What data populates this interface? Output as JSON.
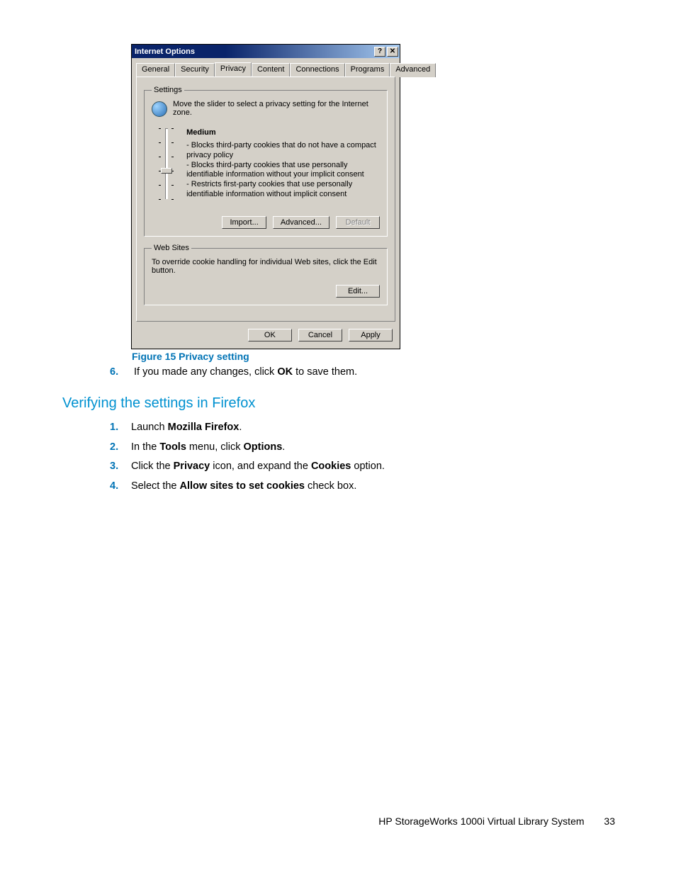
{
  "dialog": {
    "title": "Internet Options",
    "help_glyph": "?",
    "close_glyph": "✕",
    "tabs": [
      "General",
      "Security",
      "Privacy",
      "Content",
      "Connections",
      "Programs",
      "Advanced"
    ],
    "active_tab": "Privacy",
    "settings": {
      "legend": "Settings",
      "instruction": "Move the slider to select a privacy setting for the Internet zone.",
      "level": "Medium",
      "bullets": [
        "- Blocks third-party cookies that do not have a compact privacy policy",
        "- Blocks third-party cookies that use personally identifiable information without your implicit consent",
        "- Restricts first-party cookies that use personally identifiable information without implicit consent"
      ],
      "buttons": {
        "import": "Import...",
        "advanced": "Advanced...",
        "default": "Default"
      }
    },
    "websites": {
      "legend": "Web Sites",
      "text": "To override cookie handling for individual Web sites, click the Edit button.",
      "edit": "Edit..."
    },
    "buttons": {
      "ok": "OK",
      "cancel": "Cancel",
      "apply": "Apply"
    }
  },
  "caption": "Figure 15 Privacy setting",
  "step6": {
    "num": "6.",
    "pre": "If you made any changes, click ",
    "bold": "OK",
    "post": " to save them."
  },
  "section": "Verifying the settings in Firefox",
  "steps": [
    {
      "num": "1.",
      "parts": [
        "Launch ",
        "Mozilla Firefox",
        "."
      ]
    },
    {
      "num": "2.",
      "parts": [
        "In the ",
        "Tools",
        " menu, click ",
        "Options",
        "."
      ]
    },
    {
      "num": "3.",
      "parts": [
        "Click the ",
        "Privacy",
        " icon, and expand the ",
        "Cookies",
        " option."
      ]
    },
    {
      "num": "4.",
      "parts": [
        "Select the ",
        "Allow sites to set cookies",
        " check box."
      ]
    }
  ],
  "footer": {
    "text": "HP StorageWorks 1000i Virtual Library System",
    "page": "33"
  }
}
